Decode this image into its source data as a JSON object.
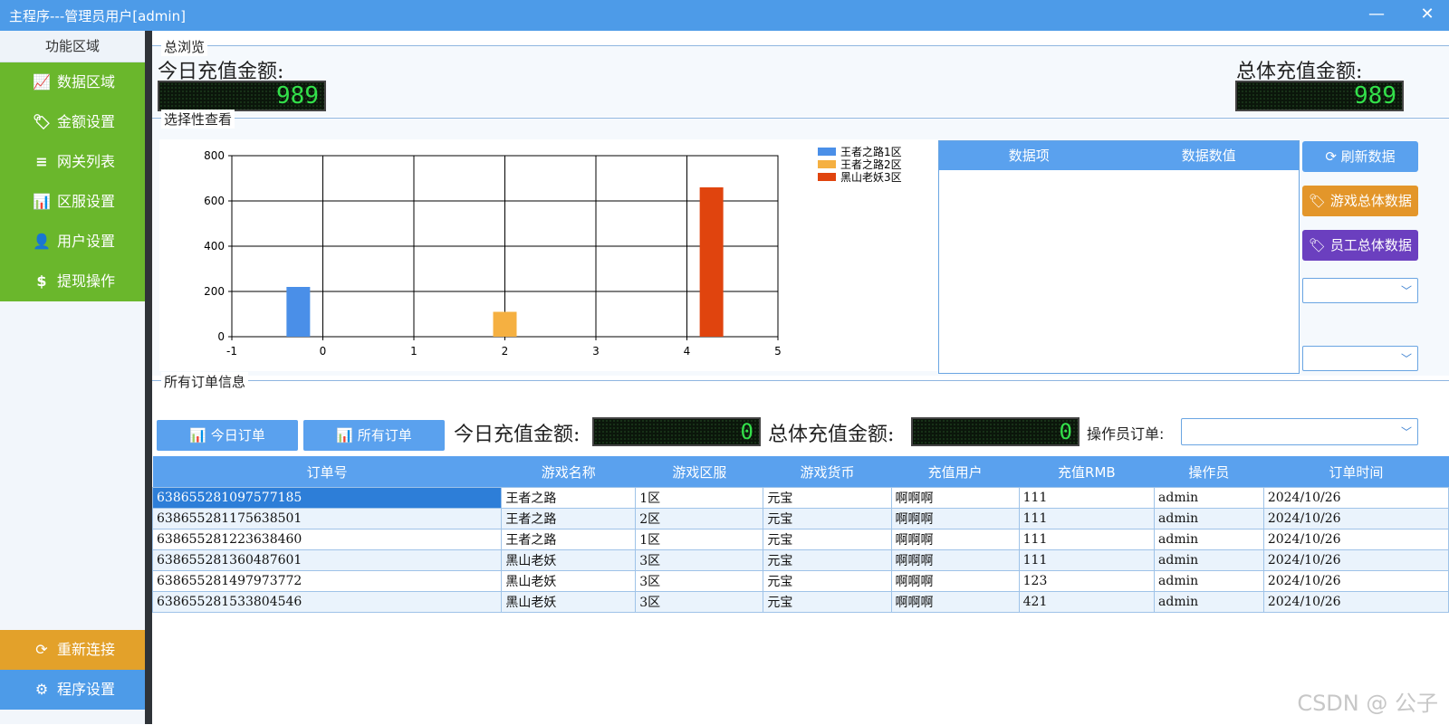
{
  "window": {
    "title": "主程序---管理员用户[admin]",
    "minimize": "—",
    "close": "✕"
  },
  "sidebar": {
    "header": "功能区域",
    "items": [
      {
        "label": "数据区域",
        "icon": "chart-line-icon",
        "glyph": "📈"
      },
      {
        "label": "金额设置",
        "icon": "tags-icon",
        "glyph": "🏷"
      },
      {
        "label": "网关列表",
        "icon": "list-icon",
        "glyph": "≡"
      },
      {
        "label": "区服设置",
        "icon": "bar-chart-icon",
        "glyph": "📊"
      },
      {
        "label": "用户设置",
        "icon": "user-icon",
        "glyph": "👤"
      },
      {
        "label": "提现操作",
        "icon": "dollar-icon",
        "glyph": "$"
      }
    ],
    "reconnect": {
      "label": "重新连接",
      "glyph": "⟳"
    },
    "settings": {
      "label": "程序设置",
      "glyph": "⚙"
    },
    "colors": {
      "green": "#6ab72c",
      "orange": "#e3a12a",
      "blue": "#4d9be8"
    }
  },
  "overview": {
    "legend": "总浏览",
    "today_label": "今日充值金额:",
    "today_value": "989",
    "total_label": "总体充值金额:",
    "total_value": "989"
  },
  "selective": {
    "legend": "选择性查看",
    "grid_headers": [
      "数据项",
      "数据数值"
    ],
    "buttons": [
      {
        "label": "刷新数据",
        "glyph": "⟳",
        "color": "#5aa1ee"
      },
      {
        "label": "游戏总体数据",
        "glyph": "🏷",
        "color": "#e3962a"
      },
      {
        "label": "员工总体数据",
        "glyph": "🏷",
        "color": "#6b3fbf"
      }
    ]
  },
  "chart_data": {
    "type": "bar",
    "series": [
      {
        "name": "王者之路1区",
        "x": -0.27,
        "value": 220,
        "color": "#4a8fe8"
      },
      {
        "name": "王者之路2区",
        "x": 2.0,
        "value": 110,
        "color": "#f5b041"
      },
      {
        "name": "黑山老妖3区",
        "x": 4.27,
        "value": 660,
        "color": "#e0440e"
      }
    ],
    "xlim": [
      -1,
      5
    ],
    "ylim": [
      0,
      800
    ],
    "xticks": [
      "-1",
      "0",
      "1",
      "2",
      "3",
      "4",
      "5"
    ],
    "yticks": [
      "0",
      "200",
      "400",
      "600",
      "800"
    ],
    "grid": true,
    "legend_position": "top-right"
  },
  "orders": {
    "legend": "所有订单信息",
    "today_btn": "今日订单",
    "all_btn": "所有订单",
    "today_label": "今日充值金额:",
    "today_value": "0",
    "total_label": "总体充值金额:",
    "total_value": "0",
    "operator_label": "操作员订单:",
    "columns": [
      "订单号",
      "游戏名称",
      "游戏区服",
      "游戏货币",
      "充值用户",
      "充值RMB",
      "操作员",
      "订单时间"
    ],
    "rows": [
      [
        "638655281097577185",
        "王者之路",
        "1区",
        "元宝",
        "啊啊啊",
        "111",
        "admin",
        "2024/10/26"
      ],
      [
        "638655281175638501",
        "王者之路",
        "2区",
        "元宝",
        "啊啊啊",
        "111",
        "admin",
        "2024/10/26"
      ],
      [
        "638655281223638460",
        "王者之路",
        "1区",
        "元宝",
        "啊啊啊",
        "111",
        "admin",
        "2024/10/26"
      ],
      [
        "638655281360487601",
        "黑山老妖",
        "3区",
        "元宝",
        "啊啊啊",
        "111",
        "admin",
        "2024/10/26"
      ],
      [
        "638655281497973772",
        "黑山老妖",
        "3区",
        "元宝",
        "啊啊啊",
        "123",
        "admin",
        "2024/10/26"
      ],
      [
        "638655281533804546",
        "黑山老妖",
        "3区",
        "元宝",
        "啊啊啊",
        "421",
        "admin",
        "2024/10/26"
      ]
    ]
  },
  "watermark": "CSDN @ 公子"
}
